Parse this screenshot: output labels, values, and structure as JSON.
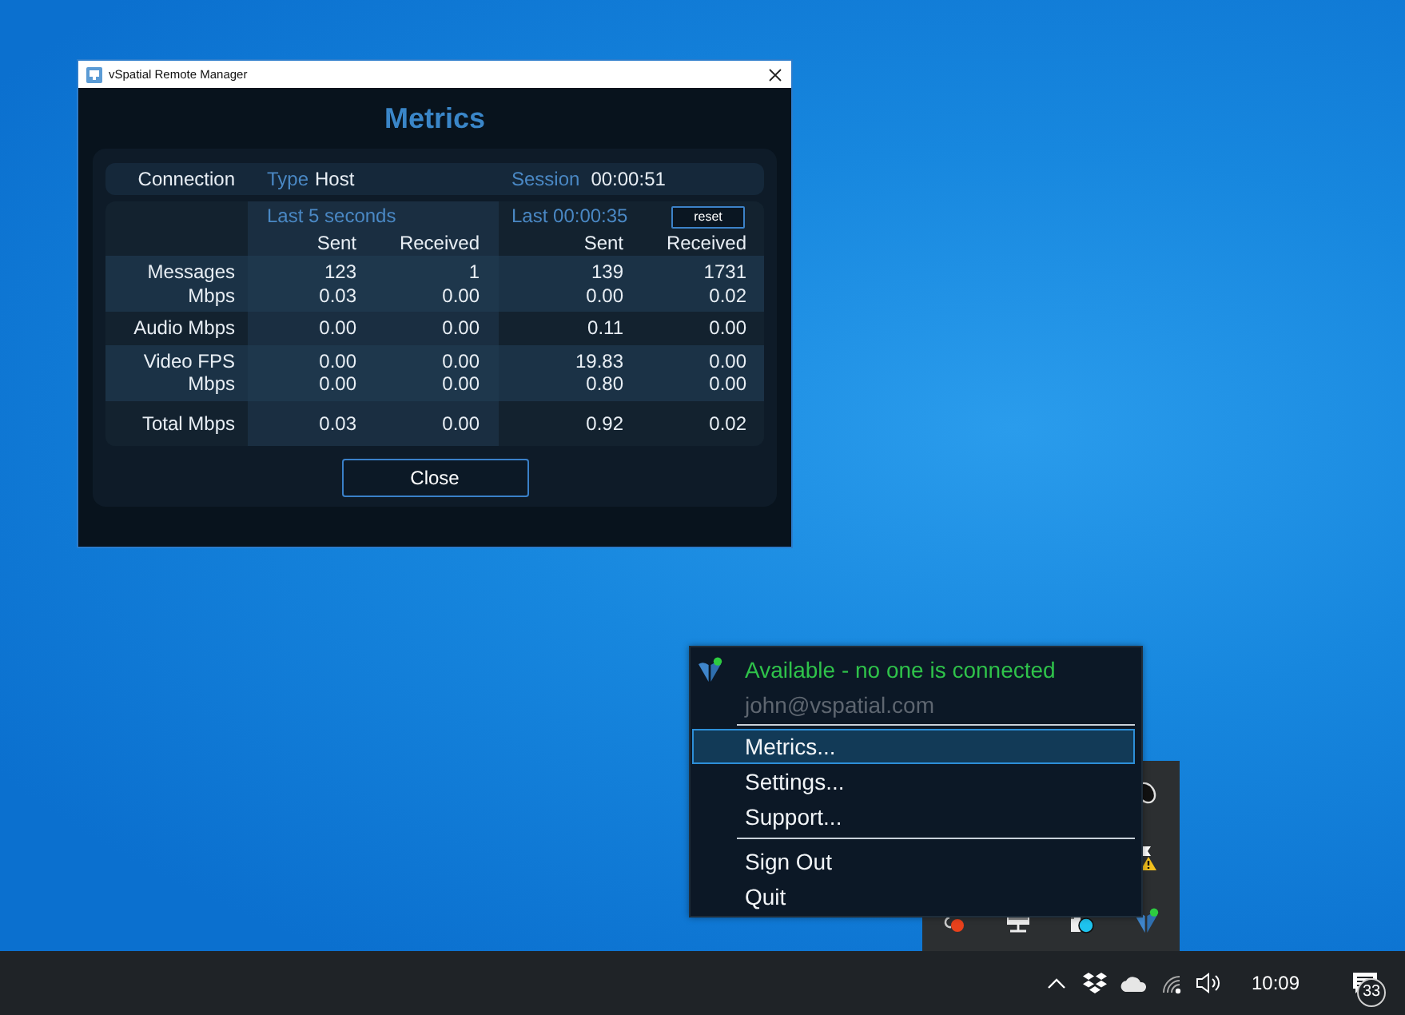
{
  "window": {
    "title": "vSpatial Remote Manager",
    "heading": "Metrics"
  },
  "connection": {
    "label": "Connection",
    "type_label": "Type",
    "type": "Host",
    "session_label": "Session",
    "session": "00:00:51"
  },
  "periods": [
    {
      "title": "Last 5 seconds"
    },
    {
      "title": "Last 00:00:35",
      "button": "reset"
    }
  ],
  "columns": [
    "Sent",
    "Received",
    "Sent",
    "Received"
  ],
  "row_groups": [
    {
      "lines": [
        {
          "label": "Messages",
          "values": [
            "123",
            "1",
            "139",
            "1731"
          ]
        },
        {
          "label": "Mbps",
          "values": [
            "0.03",
            "0.00",
            "0.00",
            "0.02"
          ]
        }
      ]
    },
    {
      "lines": [
        {
          "label": "Audio Mbps",
          "values": [
            "0.00",
            "0.00",
            "0.11",
            "0.00"
          ]
        }
      ]
    },
    {
      "lines": [
        {
          "label": "Video FPS",
          "values": [
            "0.00",
            "0.00",
            "19.83",
            "0.00"
          ]
        },
        {
          "label": "Mbps",
          "values": [
            "0.00",
            "0.00",
            "0.80",
            "0.00"
          ]
        }
      ]
    },
    {
      "lines": [
        {
          "label": "Total Mbps",
          "values": [
            "0.03",
            "0.00",
            "0.92",
            "0.02"
          ]
        }
      ]
    }
  ],
  "close_button": "Close",
  "tray_menu": {
    "status": "Available - no one is connected",
    "account": "john@vspatial.com",
    "sections": [
      {
        "items": [
          {
            "label": "Metrics...",
            "selected": true
          },
          {
            "label": "Settings...",
            "selected": false
          },
          {
            "label": "Support...",
            "selected": false
          }
        ]
      },
      {
        "items": [
          {
            "label": "Sign Out",
            "selected": false
          },
          {
            "label": "Quit",
            "selected": false
          }
        ]
      }
    ]
  },
  "taskbar": {
    "time": "10:09",
    "notifications": "33"
  }
}
